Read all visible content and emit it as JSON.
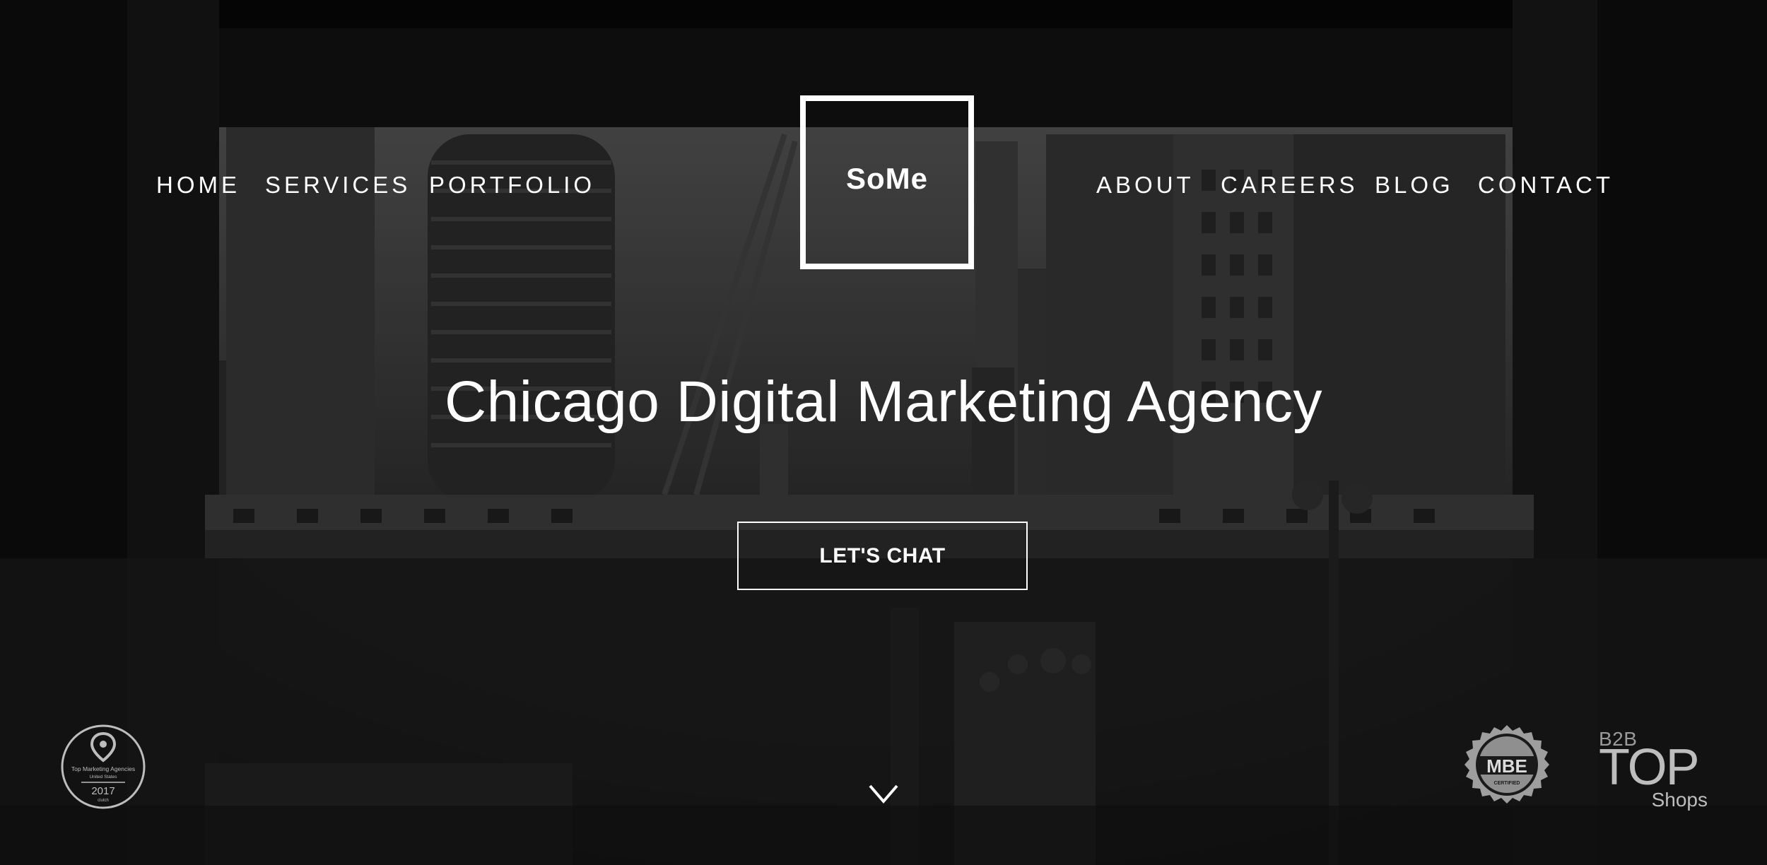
{
  "brand": {
    "logo_text": "SoMe"
  },
  "nav": {
    "left": [
      {
        "label": "HOME"
      },
      {
        "label": "SERVICES"
      },
      {
        "label": "PORTFOLIO"
      }
    ],
    "right": [
      {
        "label": "ABOUT"
      },
      {
        "label": "CAREERS"
      },
      {
        "label": "BLOG"
      },
      {
        "label": "CONTACT"
      }
    ]
  },
  "hero": {
    "headline": "Chicago Digital Marketing Agency",
    "cta_label": "LET'S CHAT",
    "scroll_icon": "chevron-down-icon"
  },
  "badges": {
    "top_agencies": {
      "title": "Top Marketing Agencies",
      "subtitle": "United States",
      "year": "2017",
      "source": "clutch"
    },
    "mbe": {
      "text": "MBE",
      "sub": "CERTIFIED"
    },
    "b2b": {
      "small": "B2B",
      "big": "TOP",
      "sub": "Shops"
    }
  },
  "colors": {
    "text": "#ffffff",
    "background": "#141414",
    "badge_gray": "#bdbdbd"
  }
}
